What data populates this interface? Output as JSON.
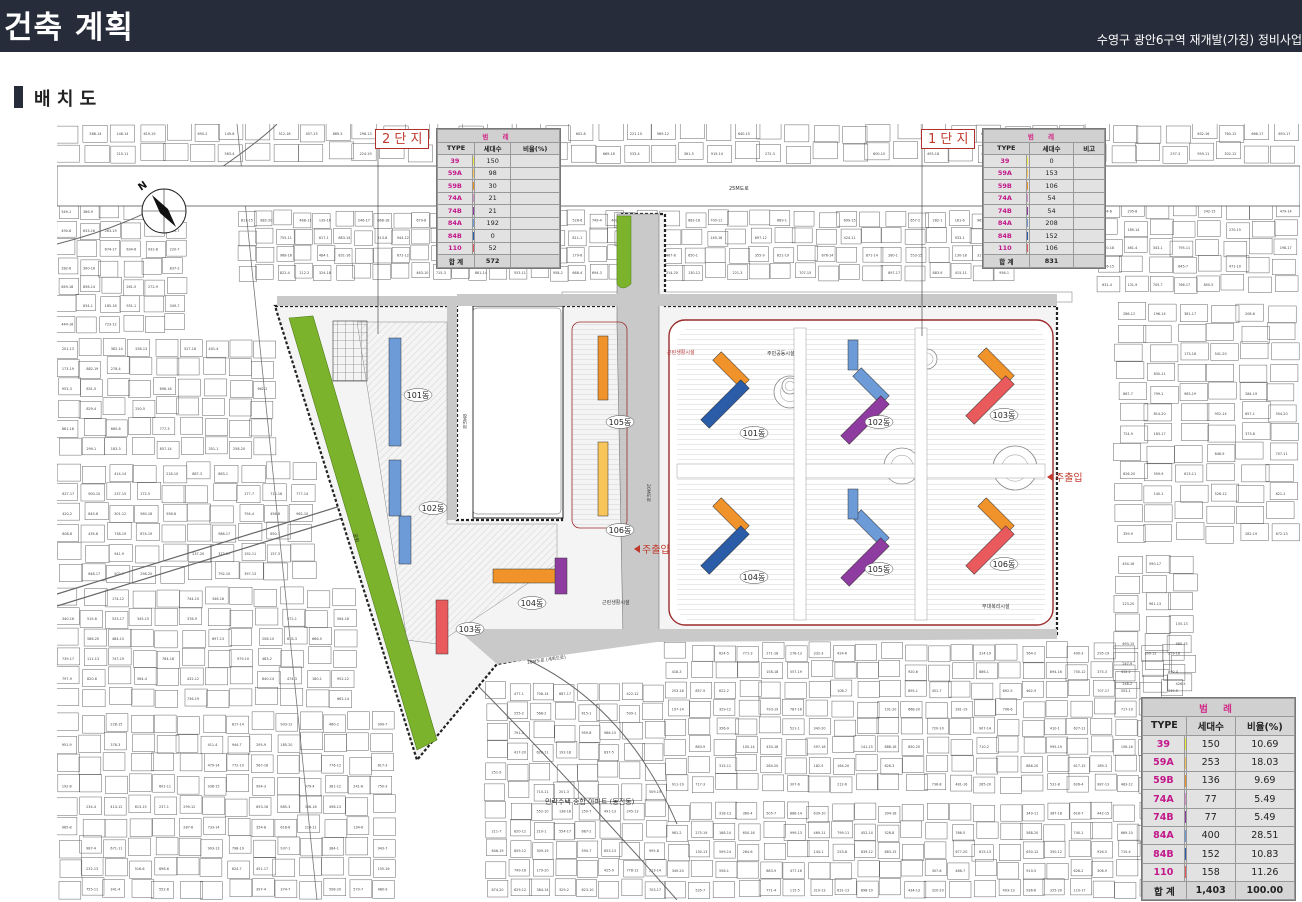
{
  "header": {
    "title": "건축 계획",
    "subtitle": "수영구 광안6구역 재개발(가칭) 정비사업"
  },
  "section": {
    "title": "배 치 도"
  },
  "map": {
    "zone2_label": "2 단 지",
    "zone1_label": "1 단 지",
    "road_north": "25M도로",
    "road_mid": "15M도로 (계획도로)",
    "road_center": "20M도로",
    "road_west": "8M도로",
    "road_south": "10M도로 (계획도로)",
    "main_entrance": "주출입",
    "apartment_label": "민락주택 종합 아파트 (동진동)",
    "park_label": "공원",
    "facility_labels": [
      "근린생활시설",
      "주민공동시설",
      "부대복리시설",
      "근린생활시설"
    ],
    "buildings_zone2": [
      "101동",
      "102동",
      "103동",
      "104동",
      "105동",
      "106동"
    ],
    "buildings_zone1": [
      "101동",
      "102동",
      "103동",
      "104동",
      "105동",
      "106동"
    ]
  },
  "legend_zone2": {
    "title": "범 례",
    "headers": [
      "TYPE",
      "세대수",
      "비율(%)"
    ],
    "rows": [
      {
        "type": "39",
        "color": "#f3ea3a",
        "count": "150",
        "ratio": ""
      },
      {
        "type": "59A",
        "color": "#f8c55a",
        "count": "98",
        "ratio": ""
      },
      {
        "type": "59B",
        "color": "#f0932b",
        "count": "30",
        "ratio": ""
      },
      {
        "type": "74A",
        "color": "#d68fce",
        "count": "21",
        "ratio": ""
      },
      {
        "type": "74B",
        "color": "#8e3ca0",
        "count": "21",
        "ratio": ""
      },
      {
        "type": "84A",
        "color": "#6c9bd8",
        "count": "192",
        "ratio": ""
      },
      {
        "type": "84B",
        "color": "#2b5ca8",
        "count": "0",
        "ratio": ""
      },
      {
        "type": "110",
        "color": "#e95a5c",
        "count": "52",
        "ratio": ""
      }
    ],
    "total_label": "합 계",
    "total_count": "572",
    "total_ratio": ""
  },
  "legend_zone1": {
    "title": "범 례",
    "headers": [
      "TYPE",
      "세대수",
      "비고"
    ],
    "rows": [
      {
        "type": "39",
        "color": "#f3ea3a",
        "count": "0",
        "ratio": ""
      },
      {
        "type": "59A",
        "color": "#f8c55a",
        "count": "153",
        "ratio": ""
      },
      {
        "type": "59B",
        "color": "#f0932b",
        "count": "106",
        "ratio": ""
      },
      {
        "type": "74A",
        "color": "#d68fce",
        "count": "54",
        "ratio": ""
      },
      {
        "type": "74B",
        "color": "#8e3ca0",
        "count": "54",
        "ratio": ""
      },
      {
        "type": "84A",
        "color": "#6c9bd8",
        "count": "208",
        "ratio": ""
      },
      {
        "type": "84B",
        "color": "#2b5ca8",
        "count": "152",
        "ratio": ""
      },
      {
        "type": "110",
        "color": "#e95a5c",
        "count": "106",
        "ratio": ""
      }
    ],
    "total_label": "합 계",
    "total_count": "831",
    "total_ratio": ""
  },
  "legend_total": {
    "title": "범 례",
    "headers": [
      "TYPE",
      "세대수",
      "비율(%)"
    ],
    "rows": [
      {
        "type": "39",
        "color": "#f3ea3a",
        "count": "150",
        "ratio": "10.69"
      },
      {
        "type": "59A",
        "color": "#f8c55a",
        "count": "253",
        "ratio": "18.03"
      },
      {
        "type": "59B",
        "color": "#f0932b",
        "count": "136",
        "ratio": "9.69"
      },
      {
        "type": "74A",
        "color": "#d68fce",
        "count": "77",
        "ratio": "5.49"
      },
      {
        "type": "74B",
        "color": "#8e3ca0",
        "count": "77",
        "ratio": "5.49"
      },
      {
        "type": "84A",
        "color": "#6c9bd8",
        "count": "400",
        "ratio": "28.51"
      },
      {
        "type": "84B",
        "color": "#2b5ca8",
        "count": "152",
        "ratio": "10.83"
      },
      {
        "type": "110",
        "color": "#e95a5c",
        "count": "158",
        "ratio": "11.26"
      }
    ],
    "total_label": "합 계",
    "total_count": "1,403",
    "total_ratio": "100.00"
  }
}
